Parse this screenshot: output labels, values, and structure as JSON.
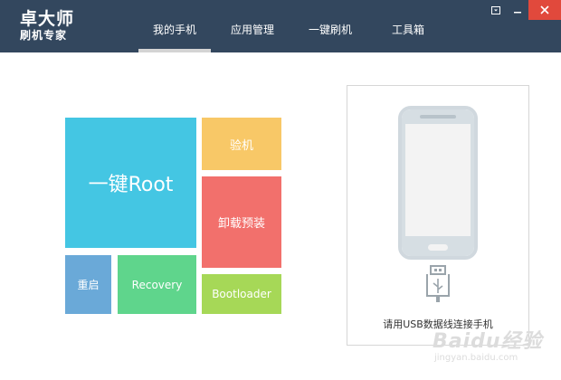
{
  "app": {
    "logo_line1": "卓大师",
    "logo_line2": "刷机专家"
  },
  "nav": {
    "tabs": [
      {
        "label": "我的手机",
        "active": true
      },
      {
        "label": "应用管理",
        "active": false
      },
      {
        "label": "一键刷机",
        "active": false
      },
      {
        "label": "工具箱",
        "active": false
      }
    ]
  },
  "window_controls": {
    "menu_icon": "dropdown-box-icon",
    "minimize_icon": "minimize-icon",
    "close_icon": "close-icon"
  },
  "tiles": {
    "root": "一键Root",
    "check": "验机",
    "uninstall": "卸载预装",
    "reboot": "重启",
    "recovery": "Recovery",
    "bootloader": "Bootloader"
  },
  "device": {
    "connect_prompt": "请用USB数据线连接手机"
  },
  "watermark": {
    "logo": "Baidu经验",
    "url": "jingyan.baidu.com"
  },
  "colors": {
    "header": "#33475e",
    "root": "#44c6e3",
    "check": "#f8c867",
    "uninstall": "#f2706c",
    "reboot": "#6aa9d8",
    "recovery": "#5fd58c",
    "bootloader": "#a6d857",
    "close": "#e1493c"
  }
}
